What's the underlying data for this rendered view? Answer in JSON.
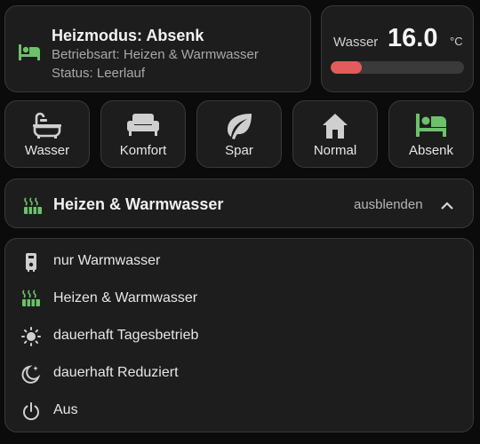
{
  "status": {
    "title": "Heizmodus: Absenk",
    "operating_mode": "Betriebsart: Heizen & Warmwasser",
    "state": "Status: Leerlauf",
    "icon": "bed-icon",
    "icon_color": "#6cc16a"
  },
  "water": {
    "label": "Wasser",
    "value": "16.0",
    "unit": "°C",
    "bar_fraction": 0.23,
    "bar_color": "#e35b5b"
  },
  "modes": [
    {
      "label": "Wasser",
      "icon": "bathtub-icon",
      "active": false
    },
    {
      "label": "Komfort",
      "icon": "sofa-icon",
      "active": false
    },
    {
      "label": "Spar",
      "icon": "leaf-icon",
      "active": false
    },
    {
      "label": "Normal",
      "icon": "home-icon",
      "active": false
    },
    {
      "label": "Absenk",
      "icon": "bed-icon",
      "active": true
    }
  ],
  "expander": {
    "title": "Heizen & Warmwasser",
    "toggle_label": "ausblenden",
    "icon": "radiator-heat-icon",
    "chevron": "chevron-up-icon"
  },
  "options": [
    {
      "label": "nur Warmwasser",
      "icon": "water-heater-icon"
    },
    {
      "label": "Heizen & Warmwasser",
      "icon": "radiator-heat-icon"
    },
    {
      "label": "dauerhaft Tagesbetrieb",
      "icon": "sun-icon"
    },
    {
      "label": "dauerhaft Reduziert",
      "icon": "moon-star-icon"
    },
    {
      "label": "Aus",
      "icon": "power-icon"
    }
  ],
  "colors": {
    "accent_green": "#6cc16a",
    "icon_gray": "#cfcfcf",
    "card_bg": "#1d1d1d",
    "page_bg": "#0b0b0b"
  }
}
